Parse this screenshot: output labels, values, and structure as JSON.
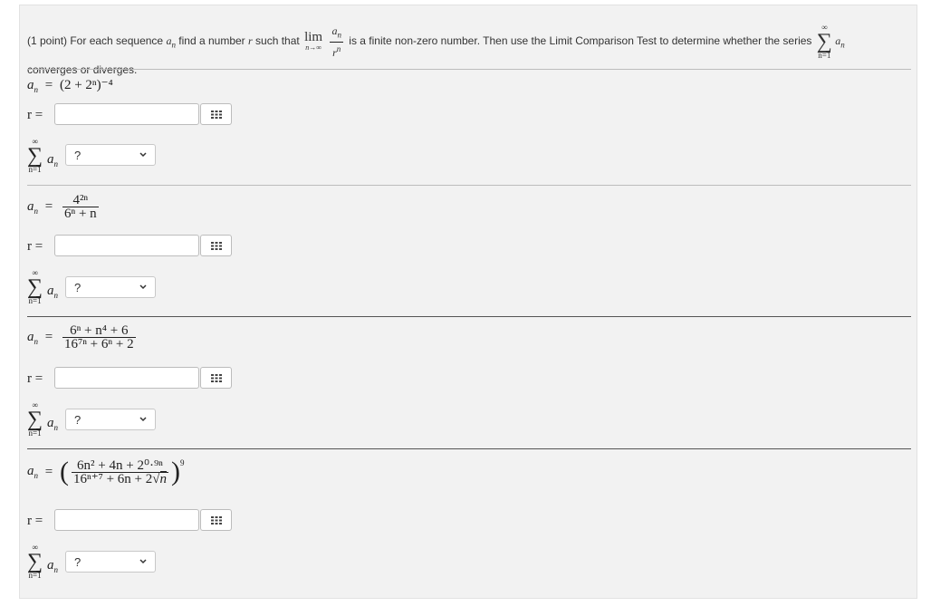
{
  "intro": {
    "prefix": "(1 point) For each sequence",
    "seq": "a",
    "seq_sub": "n",
    "find": "find a number",
    "r": "r",
    "such": "such that",
    "lim": "lim",
    "lim_under": "n→∞",
    "frac_num": "a",
    "frac_num_sub": "n",
    "frac_den": "r",
    "frac_den_sup": "n",
    "middle": "is a finite non-zero number. Then use the Limit Comparison Test to determine whether the series",
    "sum_top": "∞",
    "sum_bot": "n=1",
    "line2": "converges or diverges."
  },
  "labels": {
    "a": "a",
    "n_sub": "n",
    "eq": "=",
    "r_eq": "r =",
    "sum_top": "∞",
    "sum_sigma": "∑",
    "sum_bot": "n=1"
  },
  "problems": [
    {
      "expr": "(2 + 2ⁿ)⁻⁴",
      "r_value": "",
      "select_value": "?"
    },
    {
      "num": "4²ⁿ",
      "den": "6ⁿ + n",
      "r_value": "",
      "select_value": "?"
    },
    {
      "num": "6ⁿ + n⁴ + 6",
      "den": "16⁷ⁿ + 6ⁿ + 2",
      "r_value": "",
      "select_value": "?"
    },
    {
      "num": "6n² + 4n + 2⁰·⁹ⁿ",
      "den_a": "16ⁿ⁺⁷ + 6n + 2",
      "den_sqrt": "n",
      "outer_power": "9",
      "r_value": "",
      "select_value": "?"
    }
  ],
  "icons": {
    "keypad": "grid-icon",
    "dropdown": "chevron-down-icon"
  },
  "colors": {
    "panel_bg": "#f2f2f2",
    "rule_light": "#bdbdbd",
    "rule_dark": "#555555"
  }
}
